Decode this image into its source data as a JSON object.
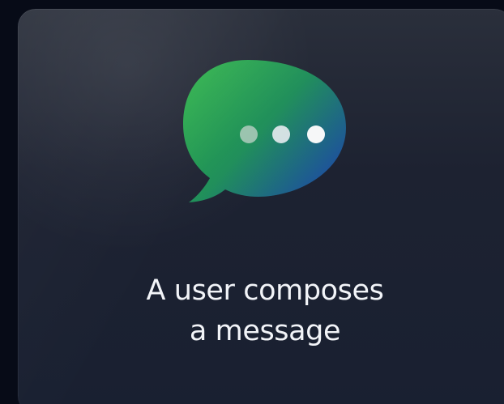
{
  "card": {
    "icon": "chat-bubble-icon",
    "caption_line1": "A user composes",
    "caption_line2": "a message"
  },
  "colors": {
    "background": "#070b17",
    "card_top": "#2a2f3b",
    "card_bottom": "#192031",
    "bubble_green": "#22a844",
    "bubble_blue": "#1d4f9f",
    "dot_light": "#f6f7f8",
    "dot_mid": "#e7ebef",
    "dot_dim": "#cbd7d0"
  }
}
